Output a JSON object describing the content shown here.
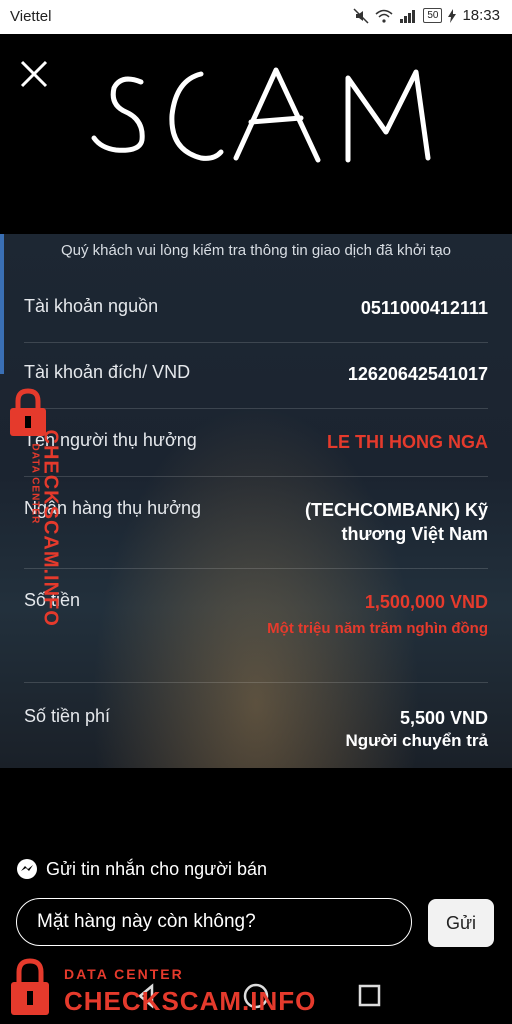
{
  "status_bar": {
    "carrier": "Viettel",
    "battery": "50",
    "time": "18:33"
  },
  "overlay": {
    "scam_text": "SCAM"
  },
  "transaction": {
    "intro": "Quý khách vui lòng kiểm tra thông tin giao dịch đã khởi tạo",
    "rows": [
      {
        "label": "Tài khoản nguồn",
        "value": "0511000412111"
      },
      {
        "label": "Tài khoản đích/ VND",
        "value": "12620642541017"
      },
      {
        "label": "Tên người thụ hưởng",
        "value": "LE THI HONG NGA"
      },
      {
        "label": "Ngân hàng thụ hưởng",
        "value": "(TECHCOMBANK) Kỹ",
        "value2": "thương Việt Nam"
      },
      {
        "label": "Số tiền",
        "value": "1,500,000 VND",
        "sub": "Một triệu năm trăm nghìn đồng"
      },
      {
        "label": "Số tiền phí",
        "value": "5,500 VND",
        "sub": "Người chuyển trả"
      }
    ]
  },
  "messenger": {
    "prompt": "Gửi tin nhắn cho người bán",
    "input_value": "Mặt hàng này còn không?",
    "send_label": "Gửi"
  },
  "watermark": {
    "line1": "DATA CENTER",
    "line2": "CHECKSCAM.INFO"
  },
  "colors": {
    "accent_red": "#e53a2c",
    "panel_bg": "#1d2733"
  }
}
